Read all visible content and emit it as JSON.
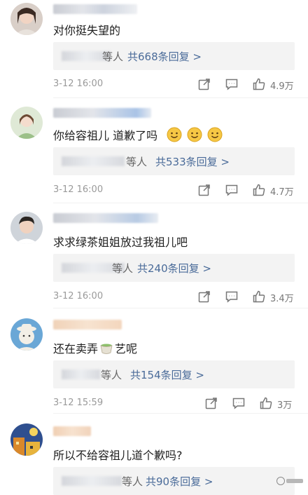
{
  "comments": [
    {
      "text": "对你挺失望的",
      "reply_suffix": "等人",
      "reply_link": "共668条回复 >",
      "time": "3-12 16:00",
      "likes": "4.9万"
    },
    {
      "text": "你给容祖儿 道歉了吗",
      "reply_suffix": "等人",
      "reply_link": "共533条回复 >",
      "time": "3-12 16:00",
      "likes": "4.7万"
    },
    {
      "text": "求求绿茶姐姐放过我祖儿吧",
      "reply_suffix": "等人",
      "reply_link": "共240条回复 >",
      "time": "3-12 16:00",
      "likes": "3.4万"
    },
    {
      "text_before": "还在卖弄",
      "text_after": "艺呢",
      "reply_suffix": "等人",
      "reply_link": "共154条回复 >",
      "time": "3-12 15:59",
      "likes": "3万"
    },
    {
      "text": "所以不给容祖儿道个歉吗?",
      "reply_suffix": "等人",
      "reply_link": "共90条回复 >",
      "time": "",
      "likes": ""
    }
  ],
  "icons": {
    "share": "share-icon",
    "comment": "comment-icon",
    "like": "thumbs-up-icon",
    "smile": "smile-emoji-icon",
    "tea": "tea-cup-emoji-icon"
  },
  "colors": {
    "reply_link": "#4a6b99",
    "reply_bg": "#f3f3f3",
    "time": "#9a9a9a"
  }
}
